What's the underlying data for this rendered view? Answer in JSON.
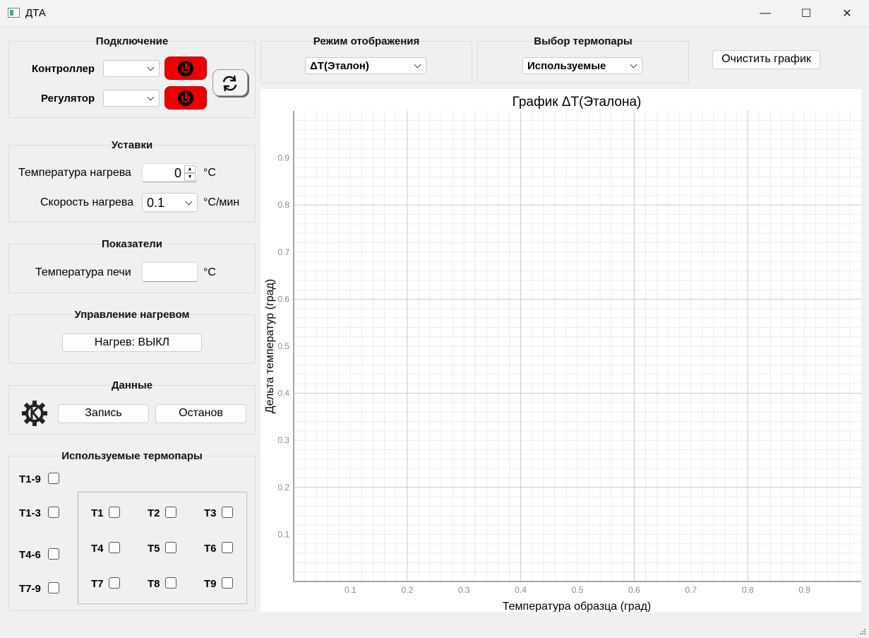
{
  "window": {
    "title": "ДТА",
    "minimize": "—",
    "maximize": "☐",
    "close": "✕"
  },
  "connection": {
    "title": "Подключение",
    "controller_label": "Контроллер",
    "regulator_label": "Регулятор",
    "controller_value": "",
    "regulator_value": ""
  },
  "setpoints": {
    "title": "Уставки",
    "heat_temp_label": "Температура нагрева",
    "heat_temp_value": "0",
    "heat_temp_unit": "°C",
    "heat_rate_label": "Скорость нагрева",
    "heat_rate_value": "0.1",
    "heat_rate_unit": "°C/мин"
  },
  "indicators": {
    "title": "Показатели",
    "furnace_temp_label": "Температура печи",
    "furnace_temp_value": "",
    "furnace_temp_unit": "°C"
  },
  "heating": {
    "title": "Управление нагревом",
    "button_label": "Нагрев: ВЫКЛ"
  },
  "data_section": {
    "title": "Данные",
    "record_label": "Запись",
    "stop_label": "Останов"
  },
  "thermocouples": {
    "title": "Используемые термопары",
    "groups": [
      "T1-9",
      "T1-3",
      "T4-6",
      "T7-9"
    ],
    "items": [
      "T1",
      "T2",
      "T3",
      "T4",
      "T5",
      "T6",
      "T7",
      "T8",
      "T9"
    ]
  },
  "display_mode": {
    "title": "Режим отображения",
    "value": "ΔT(Эталон)"
  },
  "tc_select": {
    "title": "Выбор термопары",
    "value": "Используемые"
  },
  "clear_button": "Очистить график",
  "colors": {
    "power_red": "#ee0000",
    "grid_major": "#c8c8c8",
    "grid_minor": "#ececec"
  },
  "chart_data": {
    "type": "line",
    "title": "График ΔT(Эталона)",
    "xlabel": "Температура образца (град)",
    "ylabel": "Дельта температур (град)",
    "xlim": [
      0,
      1
    ],
    "ylim": [
      0,
      1
    ],
    "xticks": [
      "0.1",
      "0.2",
      "0.3",
      "0.4",
      "0.5",
      "0.6",
      "0.7",
      "0.8",
      "0.9"
    ],
    "yticks": [
      "0.1",
      "0.2",
      "0.3",
      "0.4",
      "0.5",
      "0.6",
      "0.7",
      "0.8",
      "0.9"
    ],
    "grid": true,
    "series": []
  }
}
